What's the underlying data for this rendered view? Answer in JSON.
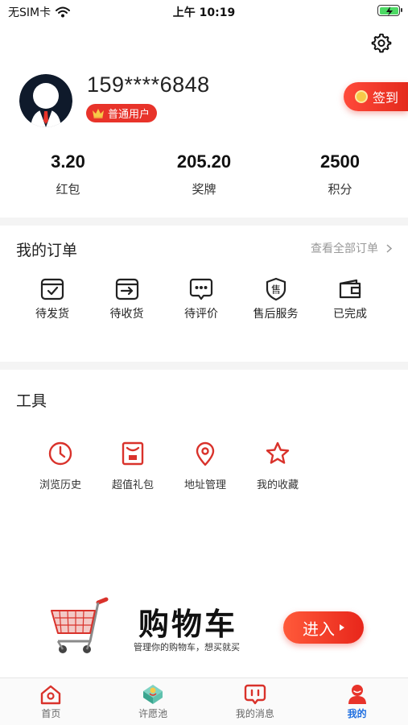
{
  "status_bar": {
    "carrier": "无SIM卡",
    "time": "上午 10:19"
  },
  "profile": {
    "phone": "159****6848",
    "member_level": "普通用户",
    "signin_label": "签到"
  },
  "stats": [
    {
      "value": "3.20",
      "label": "红包"
    },
    {
      "value": "205.20",
      "label": "奖牌"
    },
    {
      "value": "2500",
      "label": "积分"
    }
  ],
  "orders": {
    "title": "我的订单",
    "view_all": "查看全部订单",
    "items": [
      {
        "label": "待发货",
        "icon": "box-check-icon"
      },
      {
        "label": "待收货",
        "icon": "box-arrow-icon"
      },
      {
        "label": "待评价",
        "icon": "chat-dots-icon"
      },
      {
        "label": "售后服务",
        "icon": "shield-sale-icon",
        "glyph": "售"
      },
      {
        "label": "已完成",
        "icon": "wallet-icon"
      }
    ]
  },
  "tools": {
    "title": "工具",
    "items": [
      {
        "label": "浏览历史",
        "icon": "clock-icon"
      },
      {
        "label": "超值礼包",
        "icon": "gift-bag-icon"
      },
      {
        "label": "地址管理",
        "icon": "location-pin-icon"
      },
      {
        "label": "我的收藏",
        "icon": "star-icon"
      }
    ]
  },
  "cart_banner": {
    "title": "购物车",
    "subtitle": "管理你的购物车，想买就买",
    "button": "进入"
  },
  "tab_bar": [
    {
      "label": "首页",
      "icon": "home-icon",
      "active": false
    },
    {
      "label": "许愿池",
      "icon": "wish-pool-icon",
      "active": false
    },
    {
      "label": "我的消息",
      "icon": "message-icon",
      "active": false
    },
    {
      "label": "我的",
      "icon": "user-icon",
      "active": true
    }
  ],
  "colors": {
    "accent": "#e8332a",
    "active_tab": "#1f6fe0",
    "divider": "#f4f4f4"
  }
}
